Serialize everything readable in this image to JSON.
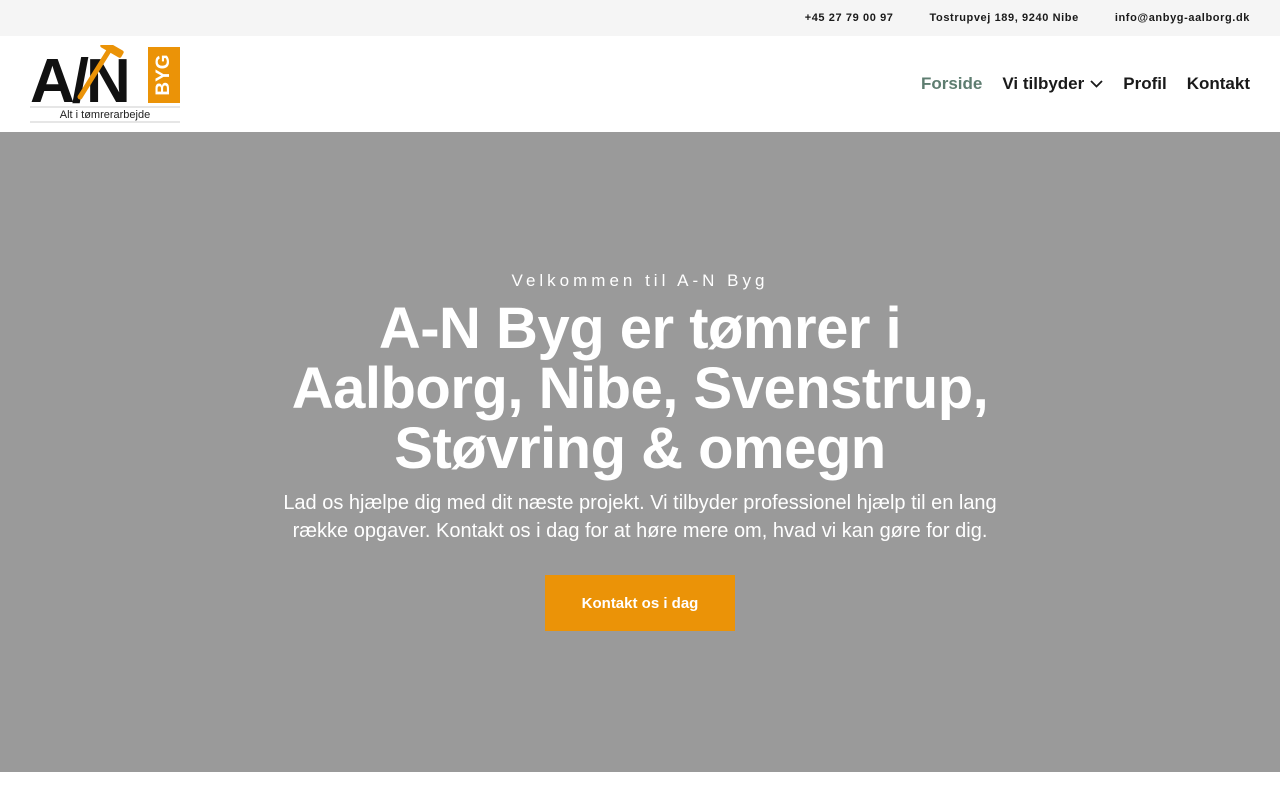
{
  "topbar": {
    "phone": "+45 27 79 00 97",
    "address": "Tostrupvej 189, 9240 Nibe",
    "email": "info@anbyg-aalborg.dk"
  },
  "logo": {
    "name": "A/N",
    "badge": "BYG",
    "tagline": "Alt i tømrerarbejde"
  },
  "nav": {
    "items": [
      {
        "label": "Forside"
      },
      {
        "label": "Vi tilbyder"
      },
      {
        "label": "Profil"
      },
      {
        "label": "Kontakt"
      }
    ]
  },
  "hero": {
    "eyebrow": "Velkommen til A-N Byg",
    "title": "A-N Byg er tømrer i Aalborg, Nibe, Svenstrup, Støvring & omegn",
    "lead": "Lad os hjælpe dig med dit næste projekt. Vi tilbyder professionel hjælp til en lang række opgaver. Kontakt os i dag for at høre mere om, hvad vi kan gøre for dig.",
    "cta_label": "Kontakt os i dag"
  },
  "colors": {
    "accent": "#eb9307",
    "nav_active": "#5e7d70",
    "hero_bg": "#9a9a9a",
    "topbar_bg": "#f5f5f5"
  }
}
